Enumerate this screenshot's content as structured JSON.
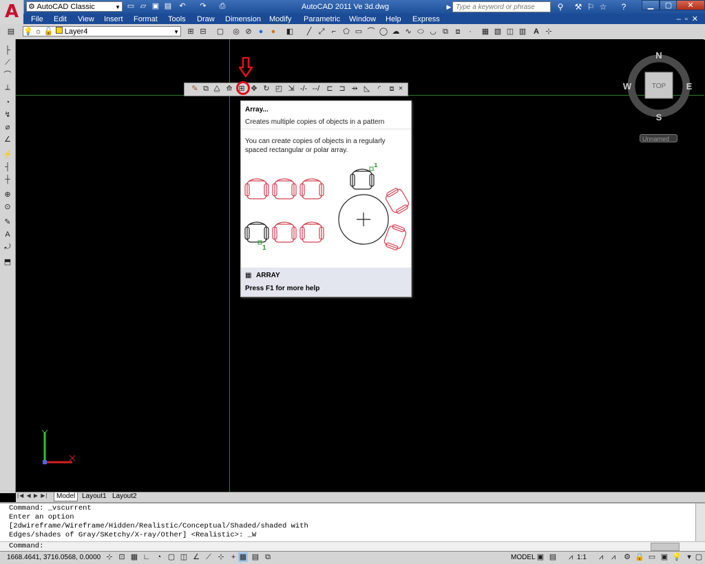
{
  "app": {
    "title": "AutoCAD 2011    Ve 3d.dwg",
    "workspace": "AutoCAD Classic",
    "search_placeholder": "Type a keyword or phrase"
  },
  "menu": [
    "File",
    "Edit",
    "View",
    "Insert",
    "Format",
    "Tools",
    "Draw",
    "Dimension",
    "Modify",
    "Parametric",
    "Window",
    "Help",
    "Express"
  ],
  "layer": {
    "current": "Layer4"
  },
  "tooltip": {
    "title": "Array...",
    "description": "Creates multiple copies of objects in a pattern",
    "body": "You can create copies of objects in a regularly spaced rectangular or polar array.",
    "label_rect": "1",
    "label_polar": "1",
    "command": "ARRAY",
    "help": "Press F1 for more help"
  },
  "viewcube": {
    "north": "N",
    "south": "S",
    "east": "E",
    "west": "W",
    "face": "TOP",
    "named_view": "Unnamed"
  },
  "tabs": {
    "model": "Model",
    "layout1": "Layout1",
    "layout2": "Layout2"
  },
  "command": {
    "lines": [
      "Command: _vscurrent",
      "Enter an option",
      "[2dwireframe/Wireframe/Hidden/Realistic/Conceptual/Shaded/shaded with",
      "Edges/shades of Gray/SKetchy/X-ray/Other] <Realistic>: _W"
    ],
    "prompt": "Command:"
  },
  "status": {
    "coordinates": "1668.4641,  3716.0568, 0.0000",
    "space": "MODEL",
    "annotation_scale": "1:1"
  },
  "colors": {
    "titlebar": "#2a5ca8",
    "highlight": "#e0101c",
    "crosshair": "#2f7d2f",
    "array_objects": "#d04050"
  }
}
